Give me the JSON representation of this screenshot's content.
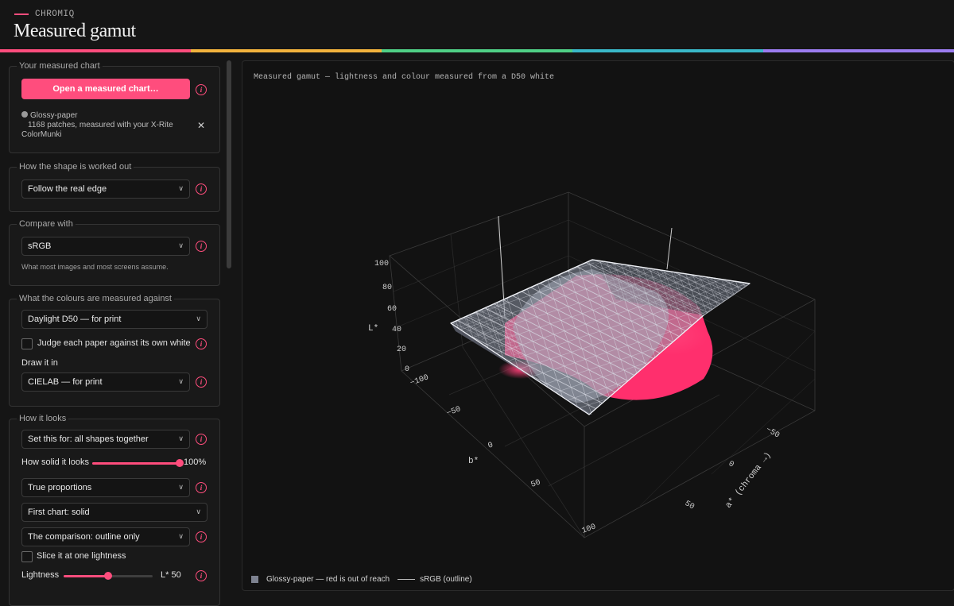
{
  "header": {
    "brand": "CHROMIQ",
    "title": "Measured gamut"
  },
  "colors": {
    "accent": "#ff4d7d",
    "rainbow": [
      "#ff4d7d",
      "#f2b33d",
      "#4fcf86",
      "#3ab8c8",
      "#9b7cf0"
    ]
  },
  "sidebar": {
    "chart_section": {
      "legend": "Your measured chart",
      "open_button": "Open a measured chart…",
      "file_name": "Glossy-paper",
      "file_detail": "1168 patches, measured with your X-Rite ColorMunki",
      "remove_icon": "close-icon"
    },
    "shape_section": {
      "legend": "How the shape is worked out",
      "method": "Follow the real edge"
    },
    "compare_section": {
      "legend": "Compare with",
      "value": "sRGB",
      "hint": "What most images and most screens assume."
    },
    "white_section": {
      "legend": "What the colours are measured against",
      "illuminant": "Daylight D50 — for print",
      "judge_label": "Judge each paper against its own white",
      "judge_checked": false,
      "draw_label": "Draw it in",
      "space": "CIELAB — for print"
    },
    "looks_section": {
      "legend": "How it looks",
      "set_for": "Set this for: all shapes together",
      "solid_label": "How solid it looks",
      "solid_value": "100%",
      "solid_fraction": 1.0,
      "proportions": "True proportions",
      "first_chart": "First chart: solid",
      "comparison": "The comparison: outline only",
      "slice_label": "Slice it at one lightness",
      "slice_checked": false,
      "lightness_label": "Lightness",
      "lightness_value": "L* 50",
      "lightness_fraction": 0.5
    }
  },
  "plot": {
    "title": "Measured gamut — lightness and colour measured from a D50 white",
    "axis_l_label": "L*",
    "axis_l_ticks": [
      "100",
      "80",
      "60",
      "40",
      "20",
      "0"
    ],
    "axis_b_label": "b*",
    "axis_b_ticks": [
      "−100",
      "−50",
      "0",
      "50",
      "100"
    ],
    "axis_a_label": "a* (chroma →)",
    "axis_a_ticks": [
      "−50",
      "0",
      "50"
    ],
    "legend_measured": "Glossy-paper — red is out of reach",
    "legend_reference": "sRGB (outline)"
  }
}
